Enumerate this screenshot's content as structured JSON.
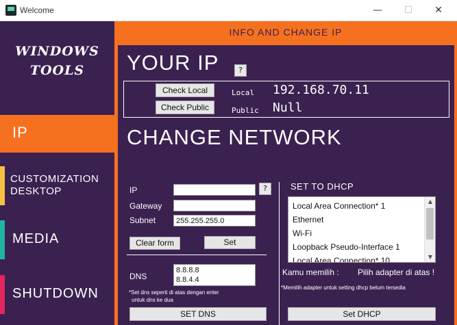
{
  "window": {
    "title": "Welcome",
    "minimize": "—",
    "maximize": "☐",
    "close": "✕"
  },
  "sidebar": {
    "logo_line1": "WINDOWS",
    "logo_line2": "TOOLS",
    "items": [
      {
        "label": "IP",
        "accent": "#f6711f",
        "active": true
      },
      {
        "label_line1": "CUSTOMIZATION",
        "label_line2": "DESKTOP",
        "accent": "#f8c146"
      },
      {
        "label": "MEDIA",
        "accent": "#1fb5a0"
      },
      {
        "label": "SHUTDOWN",
        "accent": "#e4245e"
      }
    ]
  },
  "header": {
    "title": "INFO AND CHANGE IP"
  },
  "your_ip": {
    "heading": "YOUR IP",
    "help": "?",
    "check_local_label": "Check Local",
    "check_public_label": "Check Public",
    "local_label": "Local",
    "public_label": "Public",
    "local_value": "192.168.70.11",
    "public_value": "Null"
  },
  "change_network": {
    "heading": "CHANGE NETWORK",
    "help": "?",
    "ip_label": "IP",
    "ip_value": "",
    "gateway_label": "Gateway",
    "gateway_value": "",
    "subnet_label": "Subnet",
    "subnet_value": "255.255.255.0",
    "clear_label": "Clear form",
    "set_label": "Set",
    "dns_label": "DNS",
    "dns_line1": "8.8.8.8",
    "dns_line2": "8.8.4.4",
    "dns_note_line1": "*Set dns seperti di atas  dengan enter",
    "dns_note_line2": "untuk dns ke dua",
    "set_dns_label": "SET DNS"
  },
  "dhcp": {
    "heading": "SET TO DHCP",
    "adapters": [
      "Local Area Connection* 1",
      "Ethernet",
      "Wi-Fi",
      "Loopback Pseudo-Interface 1",
      "Local Area Connection* 10"
    ],
    "chosen_label": "Kamu memilih :",
    "chosen_value": "Pilih adapter di atas !",
    "note": "*Memilih adapter untuk setting dhcp belum tersedia",
    "set_dhcp_label": "Set DHCP"
  },
  "colors": {
    "purple": "#3b2150",
    "orange": "#f6711f"
  }
}
